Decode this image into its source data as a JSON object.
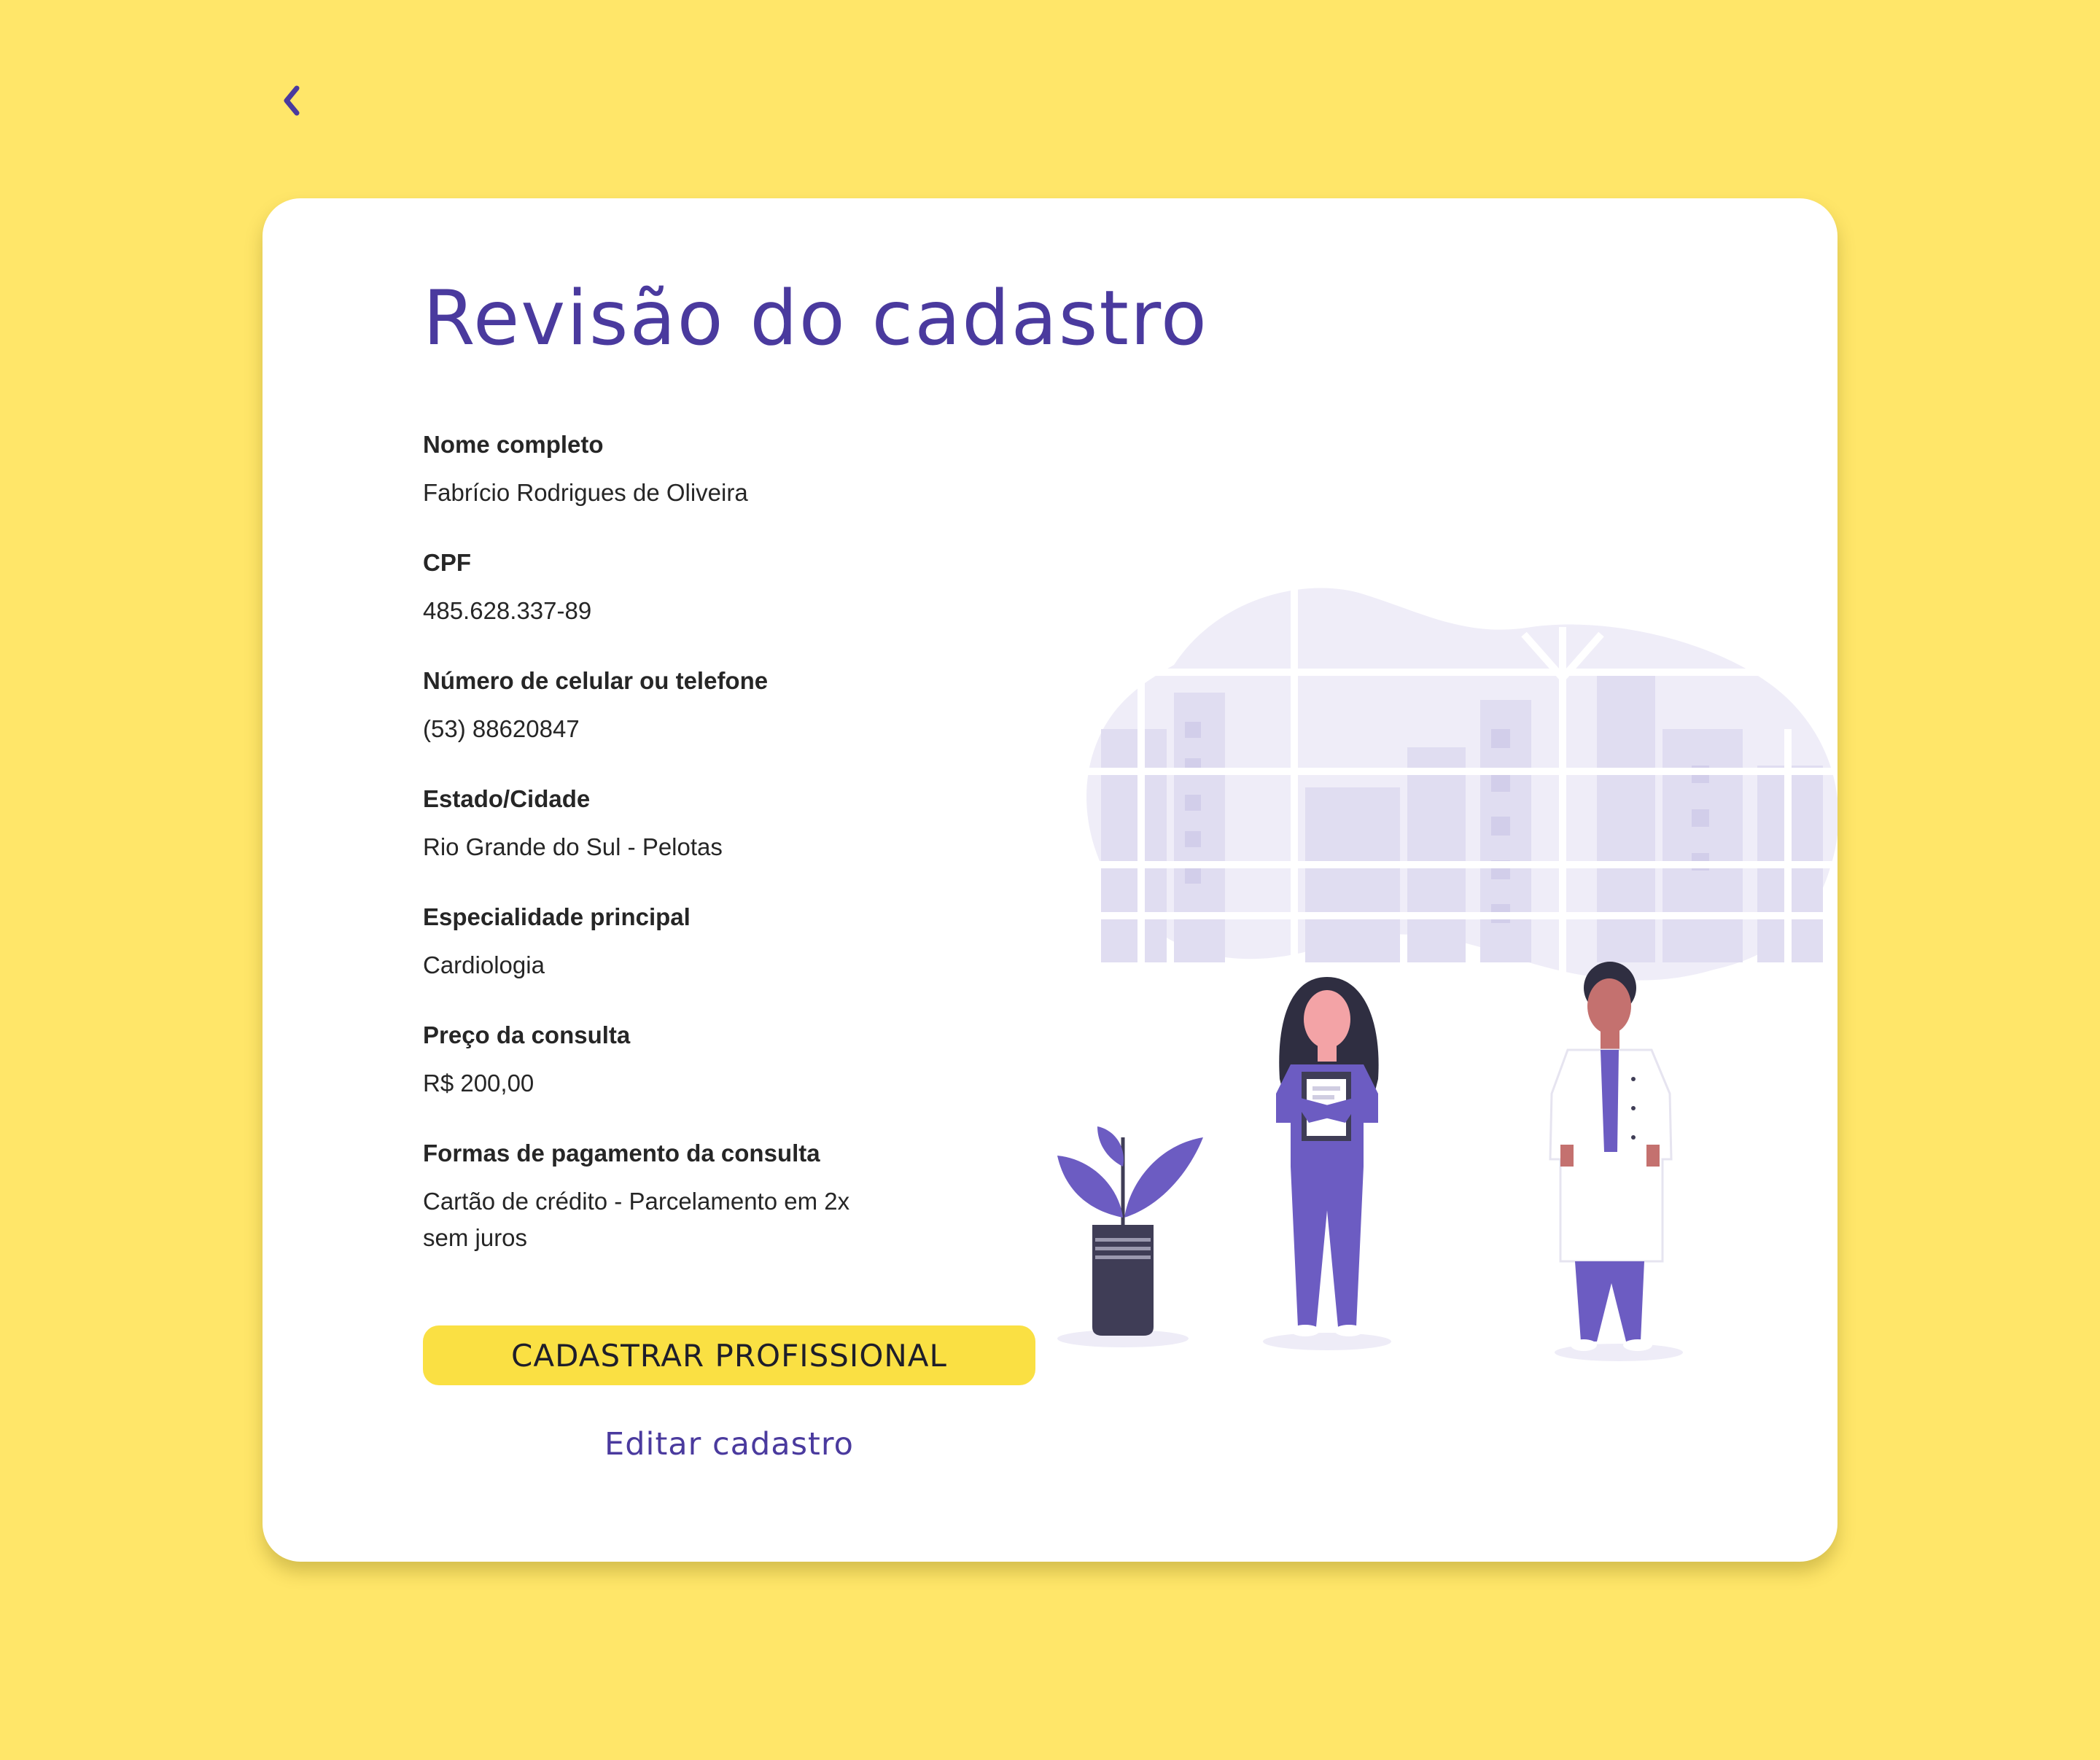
{
  "page": {
    "title": "Revisão do cadastro"
  },
  "nav": {
    "back_icon": "chevron-left-icon"
  },
  "fields": [
    {
      "label": "Nome completo",
      "value": "Fabrício Rodrigues de Oliveira"
    },
    {
      "label": "CPF",
      "value": "485.628.337-89"
    },
    {
      "label": "Número de celular ou telefone",
      "value": "(53) 88620847"
    },
    {
      "label": "Estado/Cidade",
      "value": "Rio Grande do Sul - Pelotas"
    },
    {
      "label": "Especialidade principal",
      "value": "Cardiologia"
    },
    {
      "label": "Preço da consulta",
      "value": "R$ 200,00"
    },
    {
      "label": "Formas de pagamento da consulta",
      "value": "Cartão de crédito - Parcelamento em 2x sem juros"
    }
  ],
  "actions": {
    "primary_label": "CADASTRAR PROFISSIONAL",
    "secondary_label": "Editar cadastro"
  },
  "illustration": {
    "subject": "doctors-illustration"
  },
  "colors": {
    "background": "#FFE669",
    "accent": "#4A3A9E",
    "button": "#FAE043",
    "card": "#FFFFFF",
    "illustration_purple": "#6C5CC2"
  }
}
